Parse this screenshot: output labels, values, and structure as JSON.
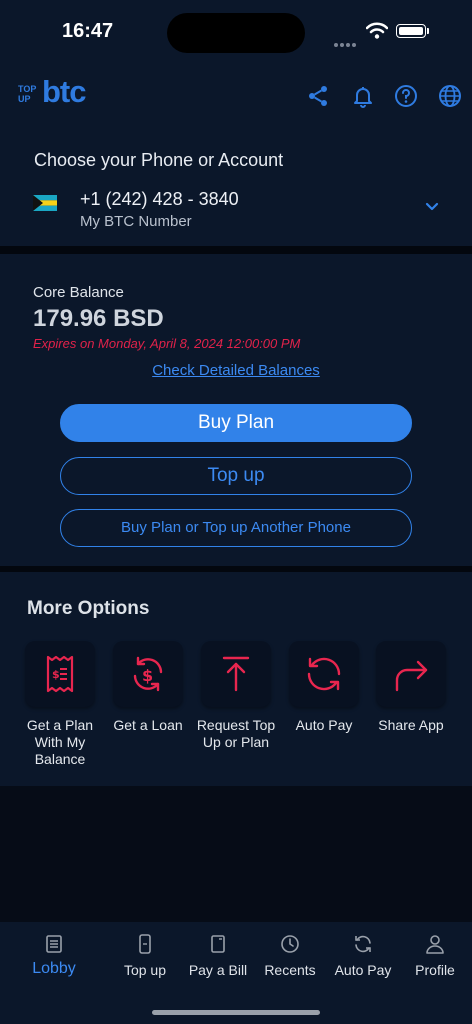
{
  "status_bar": {
    "time": "16:47"
  },
  "header": {
    "logo_small": "TOP UP",
    "logo_big": "btc"
  },
  "account": {
    "prompt": "Choose your Phone or Account",
    "phone": "+1 (242) 428 - 3840",
    "label": "My BTC Number"
  },
  "balance": {
    "label": "Core Balance",
    "amount": "179.96 BSD",
    "expires": "Expires on Monday, April 8, 2024 12:00:00 PM",
    "details_link": "Check Detailed Balances",
    "buy_plan": "Buy Plan",
    "top_up": "Top up",
    "another_phone": "Buy Plan or Top up Another Phone"
  },
  "more_options": {
    "title": "More Options",
    "items": [
      {
        "label": "Get a Plan With My Balance"
      },
      {
        "label": "Get a Loan"
      },
      {
        "label": "Request Top Up or Plan"
      },
      {
        "label": "Auto Pay"
      },
      {
        "label": "Share App"
      }
    ]
  },
  "tabs": [
    {
      "label": "Lobby"
    },
    {
      "label": "Top up"
    },
    {
      "label": "Pay a Bill"
    },
    {
      "label": "Recents"
    },
    {
      "label": "Auto Pay"
    },
    {
      "label": "Profile"
    }
  ],
  "colors": {
    "accent": "#3182e9",
    "alert": "#e0224a",
    "background": "#0b172a"
  }
}
